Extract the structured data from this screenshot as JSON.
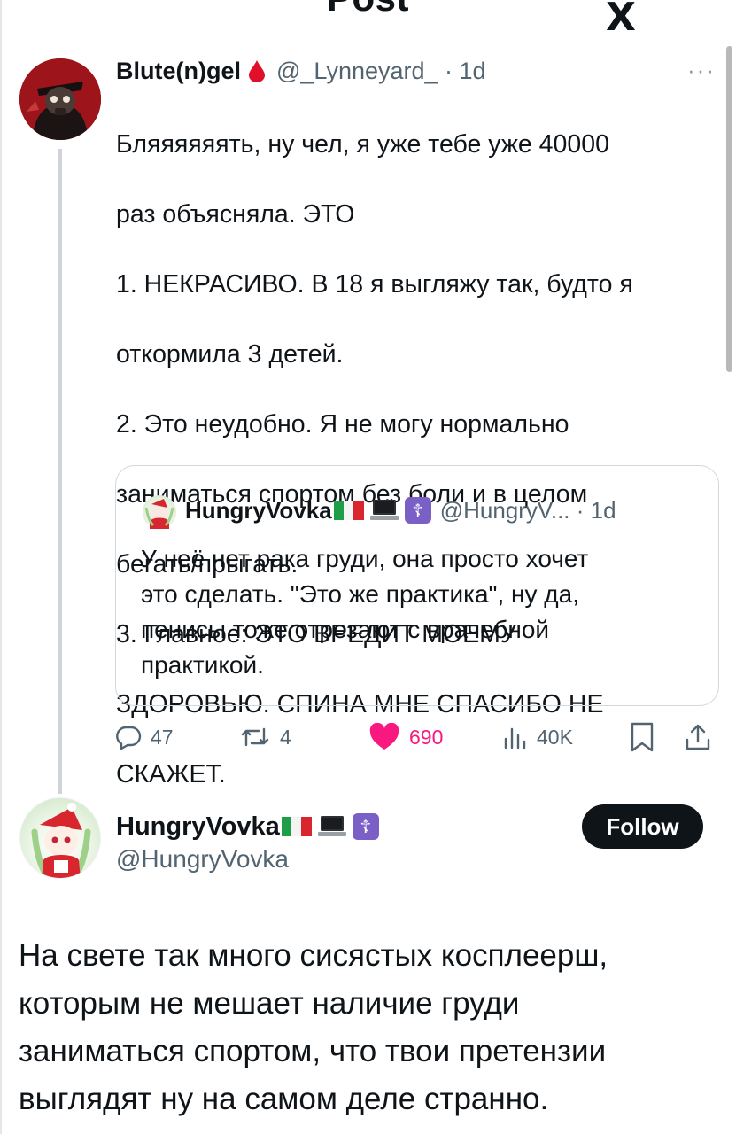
{
  "header": {
    "title": "Post",
    "logo_text": "X",
    "more_label": "···"
  },
  "tweet": {
    "author_name": "Blute(n)gel",
    "author_handle": "@_Lynneyard_ · 1d",
    "more_label": "···",
    "text_lines": [
      "Бляяяяяять, ну чел, я уже тебе уже 40000",
      "раз объясняла. ЭТО",
      "1. НЕКРАСИВО. В 18 я выгляжу так, будто я",
      "откормила 3 детей.",
      "2. Это неудобно. Я не могу нормально",
      "заниматься спортом без боли и в целом",
      "бегать/прыгать.",
      "3. Главное: ЭТО ВРЕДИТ МОЕМУ",
      "ЗДОРОВЬЮ. СПИНА МНЕ СПАСИБО НЕ",
      "СКАЖЕТ."
    ],
    "quote": {
      "author_name": "HungryVovka",
      "author_handle": "@HungryV... · 1d",
      "text_lines": [
        "У неё нет рака груди, она просто хочет",
        "это сделать. \"Это же практика\", ну да,",
        "пенисы тоже отрезают с врачебной",
        "практикой."
      ]
    },
    "stats": {
      "replies": "47",
      "reposts": "4",
      "likes": "690",
      "views": "40K"
    }
  },
  "reply": {
    "author_name": "HungryVovka",
    "author_handle": "@HungryVovka",
    "follow_label": "Follow",
    "text_lines": [
      "На свете так много сисястых косплеерш,",
      "которым не мешает наличие груди",
      "заниматься спортом, что твои претензии",
      "выглядят ну на самом деле странно."
    ]
  },
  "icons": {
    "back": "back-arrow-icon",
    "blood": "blood-drop-icon",
    "flag": "italy-flag-icon",
    "laptop": "laptop-icon",
    "cross": "orthodox-cross-icon",
    "reply": "reply-icon",
    "repost": "repost-icon",
    "like": "heart-icon",
    "views": "views-icon",
    "bookmark": "bookmark-icon",
    "share": "share-icon"
  },
  "colors": {
    "like_red": "#f91880",
    "muted_text": "#536471",
    "follow_bg": "#0f1419",
    "cross_purple": "#7a5fc7"
  }
}
